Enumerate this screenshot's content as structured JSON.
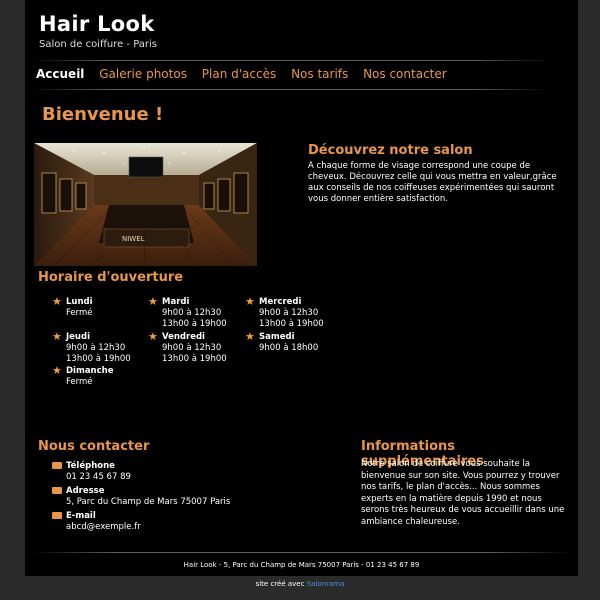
{
  "header": {
    "title": "Hair Look",
    "subtitle": "Salon de coiffure - Paris"
  },
  "nav": {
    "items": [
      "Accueil",
      "Galerie photos",
      "Plan d'accès",
      "Nos tarifs",
      "Nos contacter"
    ]
  },
  "main": {
    "welcome": "Bienvenue !",
    "discover_title": "Découvrez notre salon",
    "discover_text": "A chaque forme de visage correspond une coupe de cheveux. Découvrez celle qui vous mettra en valeur,grâce aux conseils de nos coiffeuses expérimentées qui sauront vous donner entière satisfaction.",
    "photo_sign": "NIWEL"
  },
  "hours": {
    "title": "Horaire d'ouverture",
    "days": [
      {
        "day": "Lundi",
        "times": [
          "Fermé"
        ]
      },
      {
        "day": "Mardi",
        "times": [
          "9h00 à 12h30",
          "13h00 à 19h00"
        ]
      },
      {
        "day": "Mercredi",
        "times": [
          "9h00 à 12h30",
          "13h00 à 19h00"
        ]
      },
      {
        "day": "Jeudi",
        "times": [
          "9h00 à 12h30",
          "13h00 à 19h00"
        ]
      },
      {
        "day": "Vendredi",
        "times": [
          "9h00 à 12h30",
          "13h00 à 19h00"
        ]
      },
      {
        "day": "Samedi",
        "times": [
          "9h00 à 18h00"
        ]
      },
      {
        "day": "Dimanche",
        "times": [
          "Fermé"
        ]
      }
    ]
  },
  "contact": {
    "title": "Nous contacter",
    "phone_label": "Téléphone",
    "phone": "01 23 45 67 89",
    "address_label": "Adresse",
    "address": "5, Parc du Champ de Mars 75007 Paris",
    "email_label": "E-mail",
    "email": "abcd@exemple.fr"
  },
  "info": {
    "title": "Informations supplémentaires",
    "text": "Notre salon de coiffure vous souhaite la bienvenue sur son site. Vous pourrez y trouver nos tarifs, le plan d'accès... Nous sommes experts en la matière depuis 1990 et nous serons très heureux de vous accueillir dans une ambiance chaleureuse."
  },
  "footer": {
    "text": "Hair Look - 5, Parc du Champ de Mars 75007 Paris - 01 23 45 67 89",
    "credit_prefix": "site créé avec",
    "credit_link": "Salonrama"
  },
  "colors": {
    "accent": "#e8974a",
    "background": "#000000",
    "outer": "#2b2b2b",
    "link": "#4a90d9"
  }
}
